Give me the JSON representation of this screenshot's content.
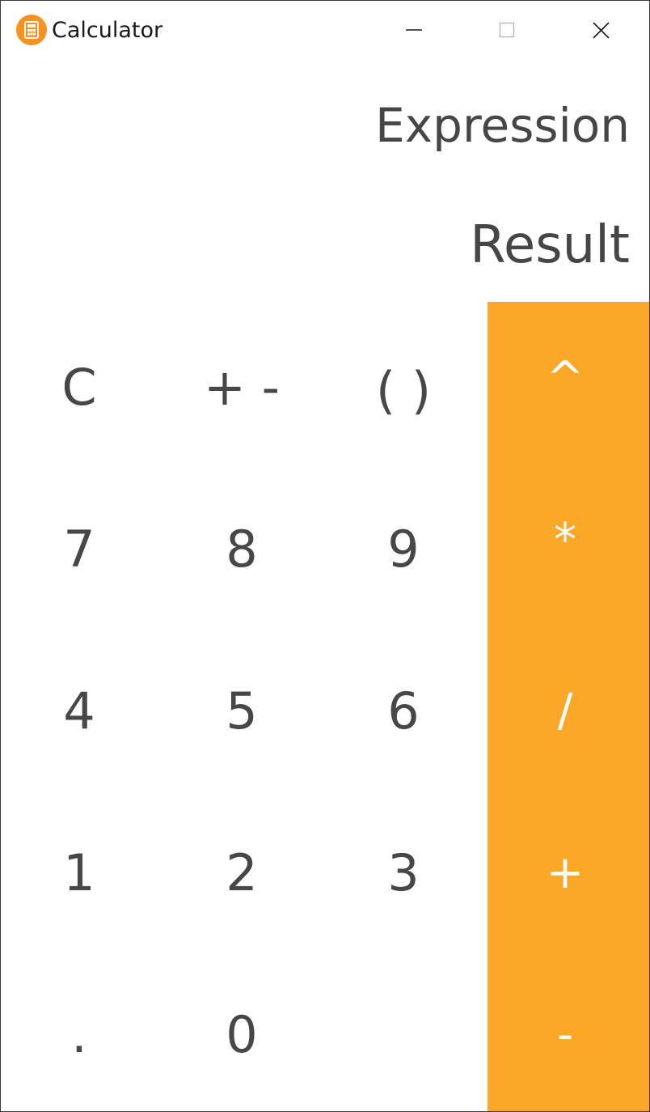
{
  "window": {
    "title": "Calculator",
    "icon": "calculator-icon",
    "controls": [
      "minimize-icon",
      "maximize-icon",
      "close-icon"
    ]
  },
  "display": {
    "expression": "Expression",
    "result": "Result"
  },
  "colors": {
    "operator_bg": "#fba728",
    "app_icon": "#f7921e",
    "text": "#464646",
    "operator_text": "#ffffff"
  },
  "keypad": {
    "rows": [
      [
        "C",
        "+ -",
        "( )",
        "^"
      ],
      [
        "7",
        "8",
        "9",
        "*"
      ],
      [
        "4",
        "5",
        "6",
        "/"
      ],
      [
        "1",
        "2",
        "3",
        "+"
      ],
      [
        ".",
        "0",
        "",
        "-"
      ]
    ]
  }
}
